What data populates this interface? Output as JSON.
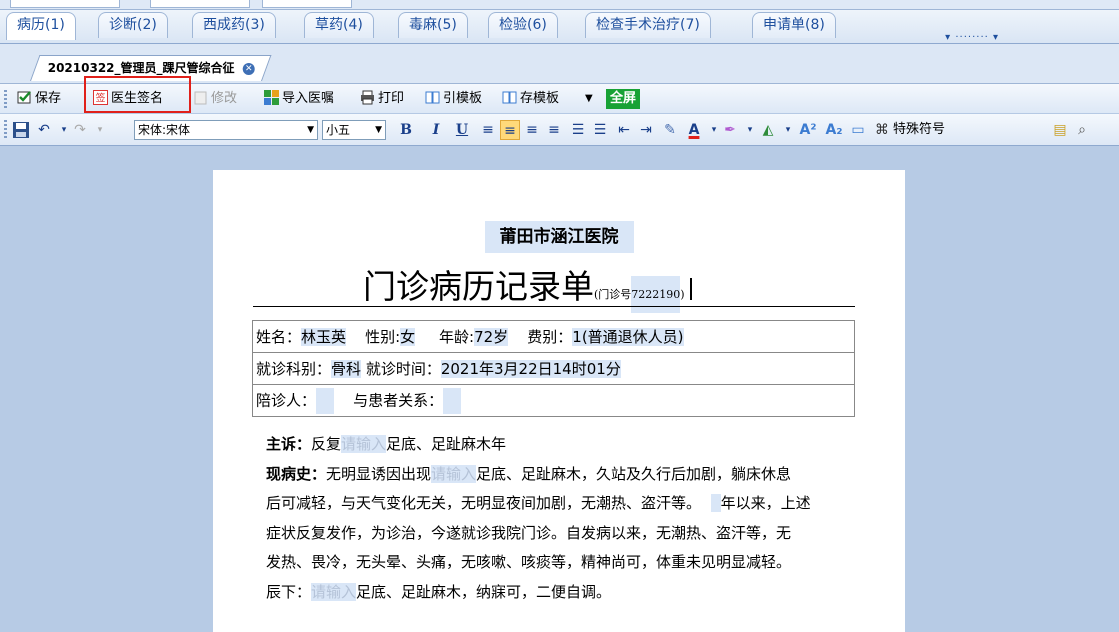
{
  "tabs": [
    {
      "label": "病历(1)",
      "active": true
    },
    {
      "label": "诊断(2)",
      "active": false
    },
    {
      "label": "西成药(3)",
      "active": false
    },
    {
      "label": "草药(4)",
      "active": false
    },
    {
      "label": "毒麻(5)",
      "active": false
    },
    {
      "label": "检验(6)",
      "active": false
    },
    {
      "label": "检查手术治疗(7)",
      "active": false
    },
    {
      "label": "申请单(8)",
      "active": false
    }
  ],
  "document_tab": {
    "label": "20210322_管理员_踝尺管综合征"
  },
  "toolbar1": {
    "save": "保存",
    "doctor_sign": "医生签名",
    "modify": "修改",
    "import_order": "导入医嘱",
    "print": "打印",
    "cite_template": "引模板",
    "save_template": "存模板",
    "fullscreen": "全屏"
  },
  "toolbar2": {
    "font_name": "宋体:宋体",
    "font_size": "小五",
    "bold": "B",
    "italic": "I",
    "underline": "U",
    "special_symbol": "特殊符号"
  },
  "record": {
    "hospital": "莆田市涵江医院",
    "title": "门诊病历记录单",
    "visit_no_label": "(门诊号",
    "visit_no": "7222190",
    "visit_no_close": ")",
    "name_label": "姓名：",
    "name": "林玉英",
    "sex_label": "性别:",
    "sex": "女",
    "age_label": "年龄:",
    "age": "72岁",
    "fee_label": "费别：",
    "fee": "1(普通退休人员)",
    "dept_label": "就诊科别：",
    "dept": "骨科",
    "time_label": "就诊时间：",
    "time": "2021年3月22日14时01分",
    "companion_label": "陪诊人：",
    "relation_label": "与患者关系：",
    "cc_label": "主诉：",
    "cc_pre": "反复",
    "placeholder": "请输入",
    "cc_post": "足底、足趾麻木年",
    "hpi_label": "现病史：",
    "hpi_pre": "无明显诱因出现",
    "hpi_l1_post": "足底、足趾麻木，久站及久行后加剧，躺床休息",
    "hpi_l2": "后可减轻，与天气变化无关，无明显夜间加剧，无潮热、盗汗等。",
    "hpi_l2_year": "年以来，上述",
    "hpi_l3": "症状反复发作，为诊治，今遂就诊我院门诊。自发病以来，无潮热、盗汗等，无",
    "hpi_l4": "发热、畏冷，无头晕、头痛，无咳嗽、咳痰等，精神尚可，体重未见明显减轻。",
    "hpi_l5_pre": "辰下：",
    "hpi_l5_post": "足底、足趾麻木，纳寐可，二便自调。"
  }
}
